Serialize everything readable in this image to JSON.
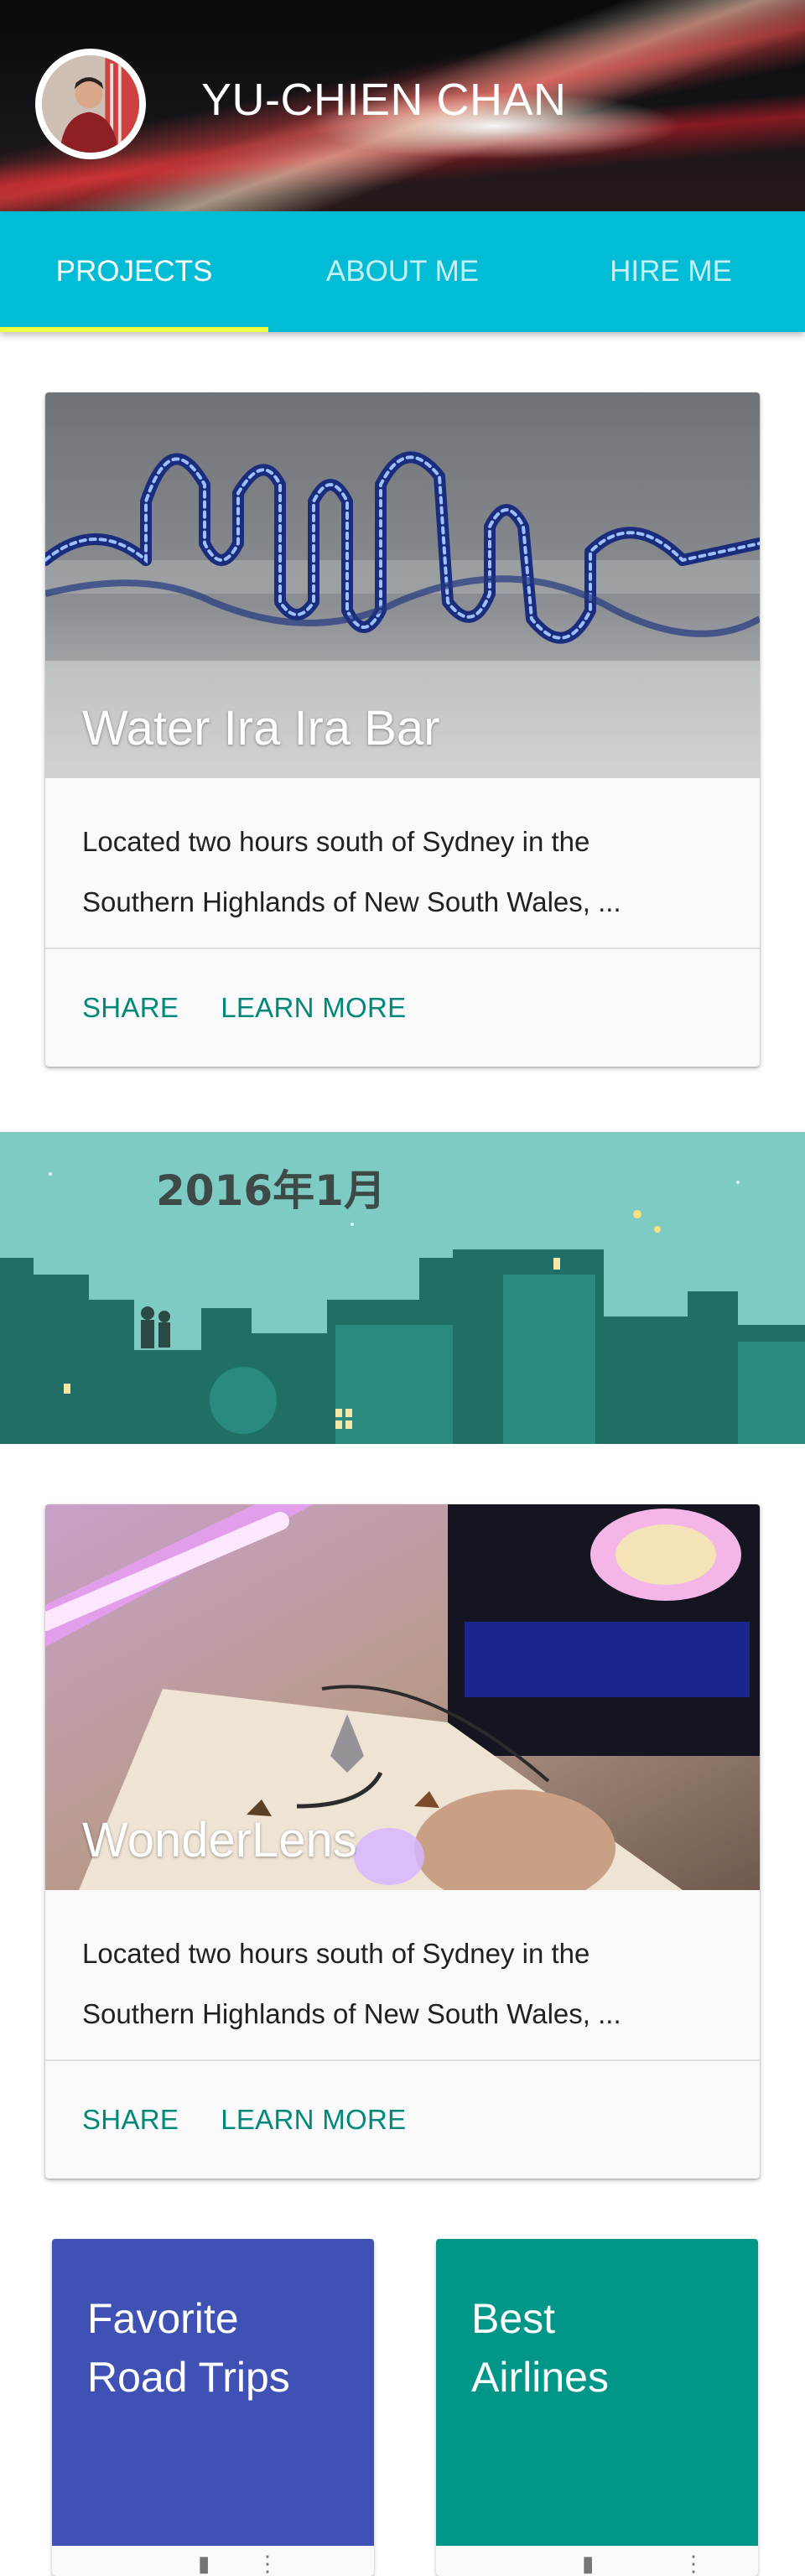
{
  "header": {
    "name": "YU-CHIEN CHAN"
  },
  "tabs": [
    {
      "label": "PROJECTS",
      "active": true
    },
    {
      "label": "ABOUT ME",
      "active": false
    },
    {
      "label": "HIRE ME",
      "active": false
    }
  ],
  "cards": [
    {
      "title": "Water Ira Ira Bar",
      "text_line1": "Located two hours south of Sydney in the",
      "text_line2": "Southern Highlands of New South Wales, ...",
      "action_share": "SHARE",
      "action_learn": "LEARN MORE"
    },
    {
      "title": "WonderLens",
      "text_line1": "Located two hours south of Sydney in the",
      "text_line2": "Southern Highlands of New South Wales, ...",
      "action_share": "SHARE",
      "action_learn": "LEARN MORE"
    }
  ],
  "banner": {
    "date_text": "2016年1月"
  },
  "tiles": [
    {
      "title": "Favorite\nRoad Trips",
      "color": "#3f51b5"
    },
    {
      "title": "Best\nAirlines",
      "color": "#009688"
    }
  ],
  "colors": {
    "tab_bar": "#00bcd4",
    "tab_indicator": "#eeff41",
    "action_text": "#00897b"
  }
}
